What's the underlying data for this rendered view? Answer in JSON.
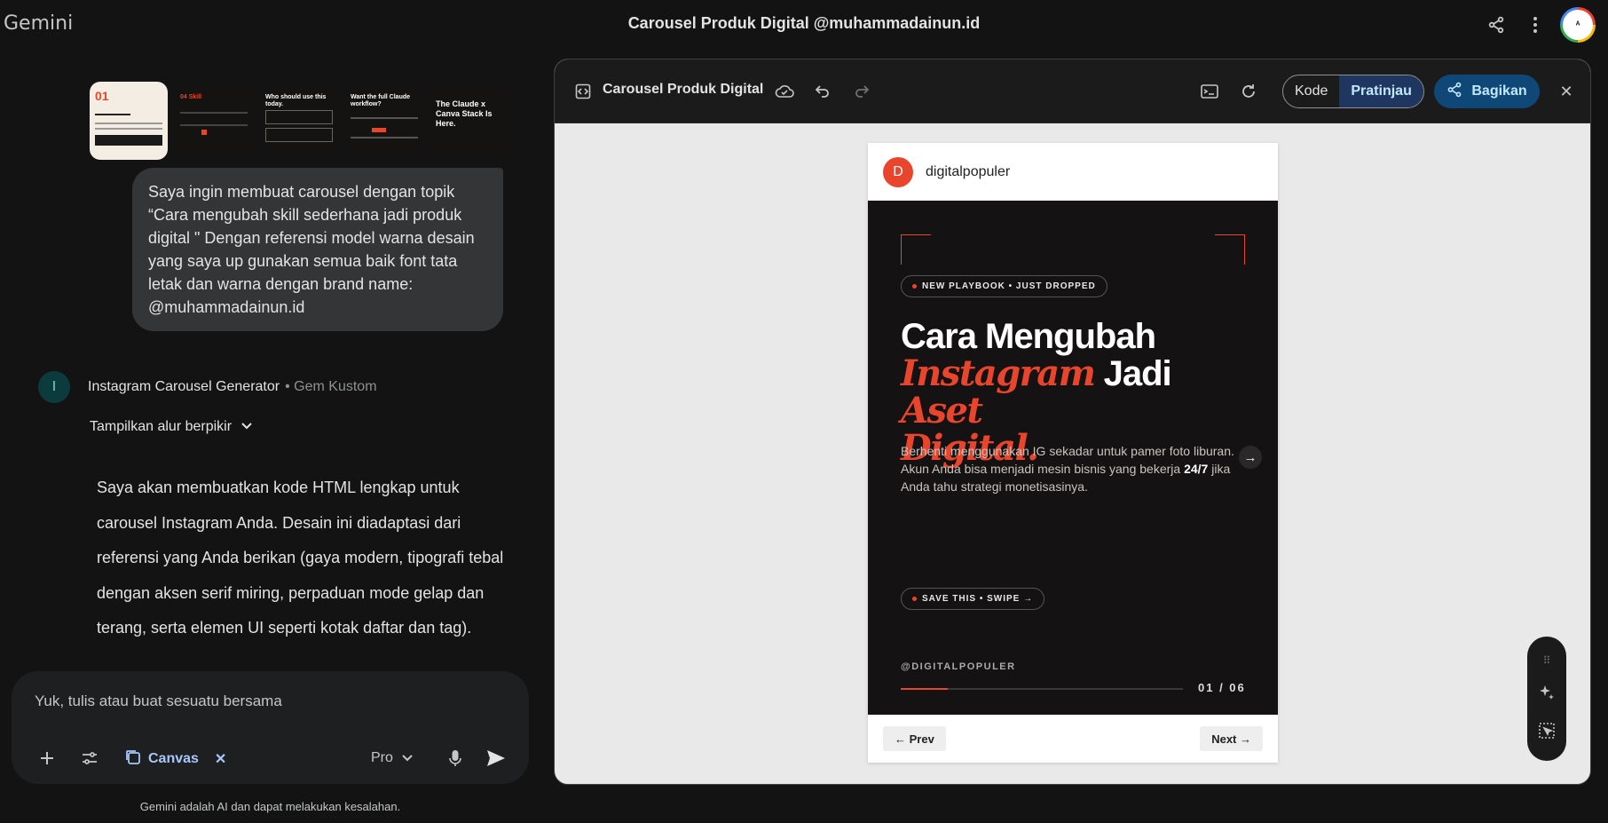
{
  "app": {
    "brand": "Gemini",
    "chat_title": "Carousel Produk Digital @muhammadainun.id"
  },
  "user_message": "Saya ingin membuat carousel dengan topik “Cara mengubah skill sederhana jadi produk digital \" Dengan referensi model warna desain yang saya up gunakan semua baik font tata letak dan warna dengan brand name: @muhammadainun.id",
  "gem": {
    "avatar_letter": "I",
    "name": "Instagram Carousel Generator",
    "tag": "• Gem Kustom",
    "thinking_toggle": "Tampilkan alur berpikir"
  },
  "response_text": "Saya akan membuatkan kode HTML lengkap untuk carousel Instagram Anda. Desain ini diadaptasi dari referensi yang Anda berikan (gaya modern, tipografi tebal dengan aksen serif miring, perpaduan mode gelap dan terang, serta elemen UI seperti kotak daftar dan tag).",
  "thumbnails": [
    {
      "title": "01"
    },
    {
      "title": "04 Skill"
    },
    {
      "title": "Who should use this today."
    },
    {
      "title": "Want the full Claude workflow?"
    },
    {
      "title": "The Claude x Canva Stack Is Here."
    }
  ],
  "composer": {
    "placeholder": "Yuk, tulis atau buat sesuatu bersama",
    "canvas_chip": "Canvas",
    "model": "Pro"
  },
  "disclaimer": "Gemini adalah AI dan dapat melakukan kesalahan.",
  "canvas": {
    "title": "Carousel Produk Digital",
    "toggle_code": "Kode",
    "toggle_preview": "Pratinjau",
    "share": "Bagikan"
  },
  "post": {
    "avatar_letter": "D",
    "username": "digitalpopuler",
    "pill_top": "NEW PLAYBOOK • JUST DROPPED",
    "headline_1": "Cara Mengubah",
    "headline_2a": "Instagram",
    "headline_2b": "Jadi",
    "headline_2c": "Aset",
    "headline_3": "Digital.",
    "sub_1": "Berhenti menggunakan IG sekadar untuk pamer foto liburan. Akun Anda bisa menjadi mesin bisnis yang bekerja ",
    "sub_bold": "24/7",
    "sub_2": " jika Anda tahu strategi monetisasinya.",
    "pill_bottom": "SAVE THIS • SWIPE →",
    "handle": "@DIGITALPOPULER",
    "counter": "01 / 06",
    "progress_fraction": 0.167,
    "prev": "← Prev",
    "next": "Next →"
  },
  "colors": {
    "accent": "#e8452c",
    "slide_bg": "#141212",
    "canvas_bg": "#e9e9e9",
    "app_bg": "#131314"
  }
}
